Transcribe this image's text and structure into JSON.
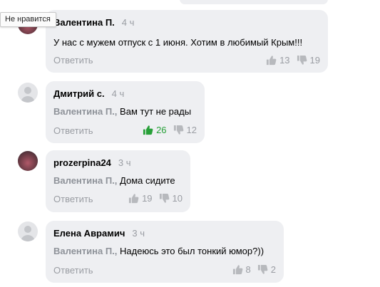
{
  "tooltip": {
    "text": "Не нравится"
  },
  "reply_label": "Ответить",
  "comments": [
    {
      "author": "Валентина П.",
      "time": "4 ч",
      "reply_to": "",
      "text": "У нас с мужем отпуск с 1 июня. Хотим в любимый Крым!!!",
      "likes": "13",
      "dislikes": "19",
      "liked": false
    },
    {
      "author": "Дмитрий с.",
      "time": "4 ч",
      "reply_to": "Валентина П.,",
      "text": "Вам тут не рады",
      "likes": "26",
      "dislikes": "12",
      "liked": true
    },
    {
      "author": "prozerpina24",
      "time": "3 ч",
      "reply_to": "Валентина П.,",
      "text": "Дома сидите",
      "likes": "19",
      "dislikes": "10",
      "liked": false
    },
    {
      "author": "Елена Аврамич",
      "time": "3 ч",
      "reply_to": "Валентина П.,",
      "text": "Надеюсь это был тонкий юмор?))",
      "likes": "8",
      "dislikes": "2",
      "liked": false
    }
  ],
  "colors": {
    "card_bg": "#eeeff2",
    "meta_gray": "#9a9da3",
    "like_green": "#27a038"
  }
}
